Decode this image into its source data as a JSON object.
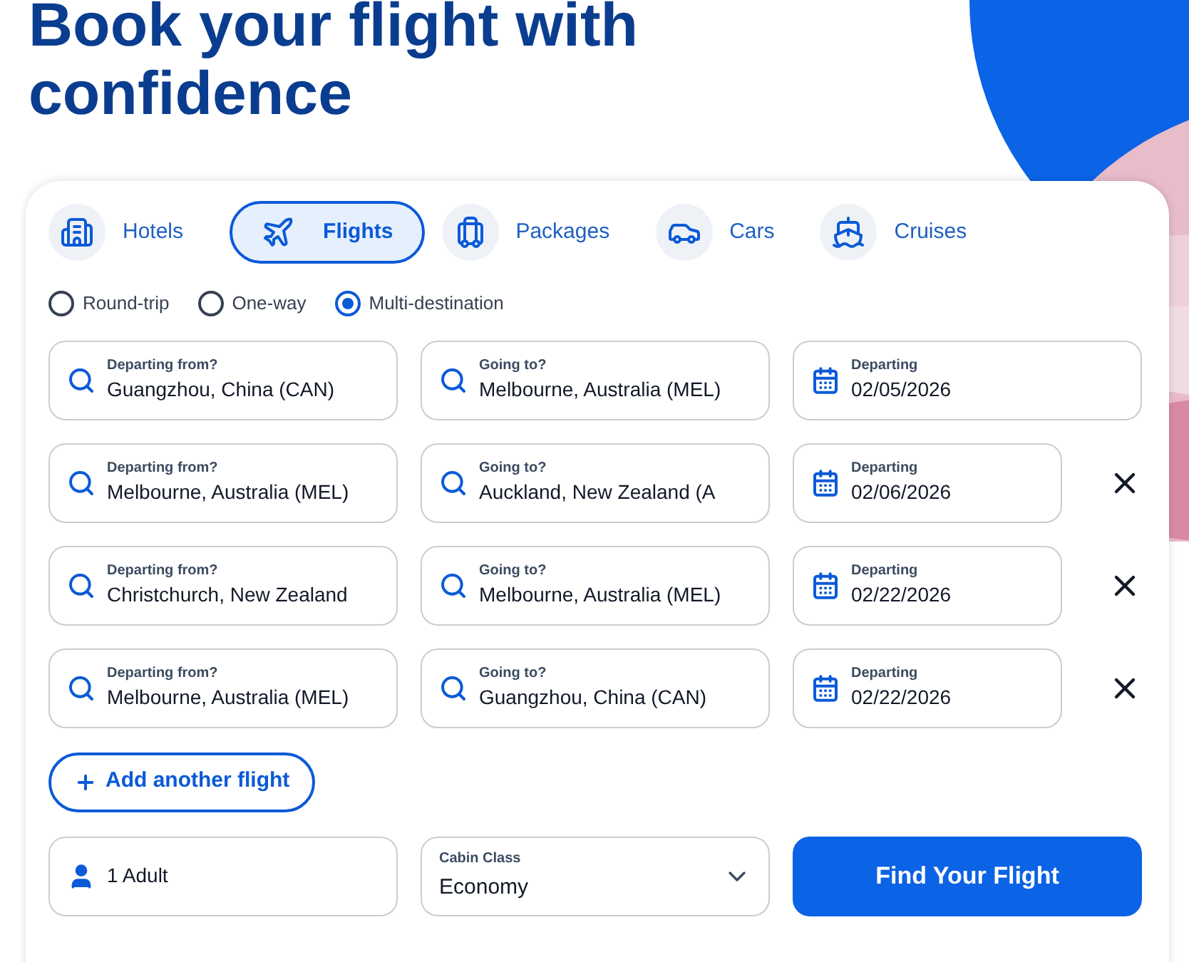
{
  "heading": "Book your flight with confidence",
  "tabs": [
    {
      "label": "Hotels",
      "kind": "hotel",
      "selected": false
    },
    {
      "label": "Flights",
      "kind": "plane",
      "selected": true
    },
    {
      "label": "Packages",
      "kind": "luggage",
      "selected": false
    },
    {
      "label": "Cars",
      "kind": "car",
      "selected": false
    },
    {
      "label": "Cruises",
      "kind": "ship",
      "selected": false
    }
  ],
  "trip_types": [
    {
      "label": "Round-trip",
      "selected": false
    },
    {
      "label": "One-way",
      "selected": false
    },
    {
      "label": "Multi-destination",
      "selected": true
    }
  ],
  "legs": [
    {
      "from_label": "Departing from?",
      "from": "Guangzhou, China (CAN)",
      "to_label": "Going to?",
      "to": "Melbourne, Australia (MEL)",
      "date_label": "Departing",
      "date": "02/05/2026",
      "removable": false
    },
    {
      "from_label": "Departing from?",
      "from": "Melbourne, Australia (MEL)",
      "to_label": "Going to?",
      "to": "Auckland, New Zealand (A",
      "date_label": "Departing",
      "date": "02/06/2026",
      "removable": true
    },
    {
      "from_label": "Departing from?",
      "from": "Christchurch, New Zealand",
      "to_label": "Going to?",
      "to": "Melbourne, Australia (MEL)",
      "date_label": "Departing",
      "date": "02/22/2026",
      "removable": true
    },
    {
      "from_label": "Departing from?",
      "from": "Melbourne, Australia (MEL)",
      "to_label": "Going to?",
      "to": "Guangzhou, China (CAN)",
      "date_label": "Departing",
      "date": "02/22/2026",
      "removable": true
    }
  ],
  "add_flight": "Add another flight",
  "travelers": "1 Adult",
  "cabin": {
    "label": "Cabin Class",
    "value": "Economy"
  },
  "search_button": "Find Your Flight"
}
